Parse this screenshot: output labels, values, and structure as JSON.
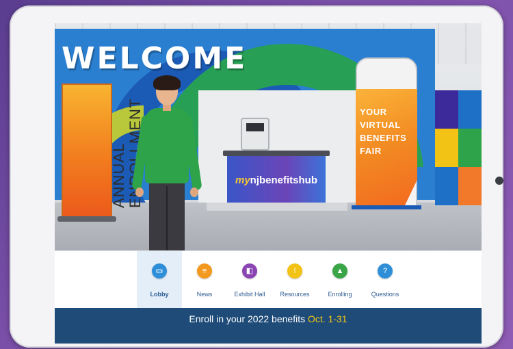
{
  "scene": {
    "welcome": "WELCOME",
    "banner_left": "ANNUAL\nENROLLMENT",
    "booth_logo_my": "my",
    "booth_logo_rest": "njbenefitshub",
    "tower_text": "YOUR VIRTUAL BENEFITS FAIR"
  },
  "nav": {
    "items": [
      {
        "label": "Lobby",
        "icon": "lobby-icon",
        "color": "#2e8fd8",
        "active": true
      },
      {
        "label": "News",
        "icon": "news-icon",
        "color": "#f39a1e"
      },
      {
        "label": "Exhibit Hall",
        "icon": "exhibit-hall-icon",
        "color": "#8b45b2"
      },
      {
        "label": "Resources",
        "icon": "resources-icon",
        "color": "#f2c315"
      },
      {
        "label": "Enrolling",
        "icon": "enrolling-icon",
        "color": "#3aa648"
      },
      {
        "label": "Questions",
        "icon": "questions-icon",
        "color": "#2e8fd8"
      }
    ]
  },
  "footer": {
    "text": "Enroll in your 2022 benefits ",
    "date": "Oct. 1-31"
  },
  "colors": {
    "footer_bg": "#1e4b78",
    "accent_yellow": "#f4c516",
    "active_tab_bg": "#e3eef9"
  }
}
